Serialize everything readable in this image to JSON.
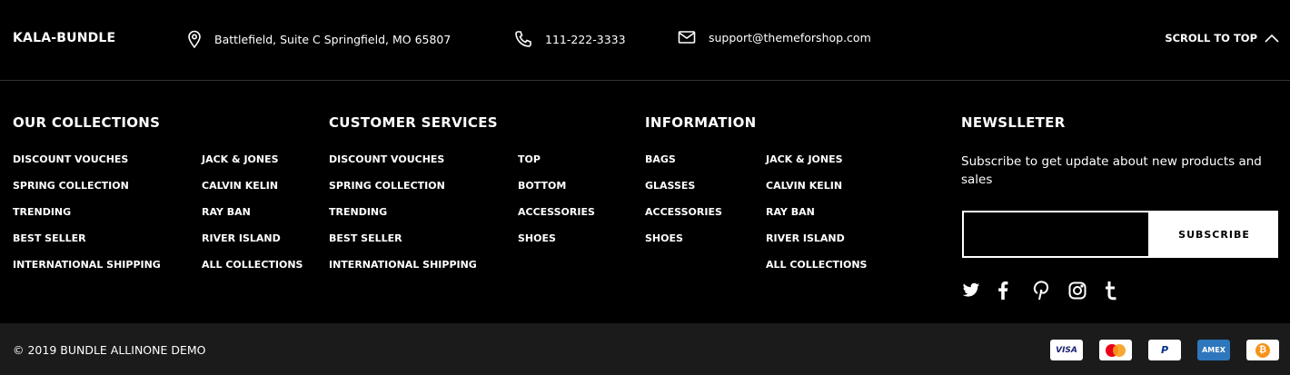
{
  "header": {
    "brand": "KALA-BUNDLE",
    "address": "Battlefield, Suite C Springfield, MO 65807",
    "phone": "111-222-3333",
    "email": "support@themeforshop.com",
    "scroll_top": "SCROLL TO TOP"
  },
  "columns": {
    "collections": {
      "title": "OUR COLLECTIONS",
      "left": [
        "DISCOUNT VOUCHES",
        "SPRING COLLECTION",
        "TRENDING",
        "BEST SELLER",
        "INTERNATIONAL SHIPPING"
      ],
      "right": [
        "JACK & JONES",
        "CALVIN KELIN",
        "RAY BAN",
        "RIVER ISLAND",
        "ALL COLLECTIONS"
      ]
    },
    "services": {
      "title": "CUSTOMER SERVICES",
      "left": [
        "DISCOUNT VOUCHES",
        "SPRING COLLECTION",
        "TRENDING",
        "BEST SELLER",
        "INTERNATIONAL SHIPPING"
      ],
      "right": [
        "TOP",
        "BOTTOM",
        "ACCESSORIES",
        "SHOES"
      ]
    },
    "information": {
      "title": "INFORMATION",
      "left": [
        "BAGS",
        "GLASSES",
        "ACCESSORIES",
        "SHOES"
      ],
      "right": [
        "JACK & JONES",
        "CALVIN KELIN",
        "RAY BAN",
        "RIVER ISLAND",
        "ALL COLLECTIONS"
      ]
    }
  },
  "newsletter": {
    "title": "NEWSLLETER",
    "text": "Subscribe to get update about new products and sales",
    "placeholder": "",
    "button": "SUBSCRIBE",
    "social": [
      "twitter-icon",
      "facebook-icon",
      "pinterest-icon",
      "instagram-icon",
      "tumblr-icon"
    ]
  },
  "footer": {
    "copyright": "© 2019 BUNDLE ALLINONE DEMO",
    "payments": {
      "visa": "VISA",
      "mastercard": "",
      "paypal": "P",
      "amex": "AMEX",
      "bitcoin": "₿"
    }
  }
}
